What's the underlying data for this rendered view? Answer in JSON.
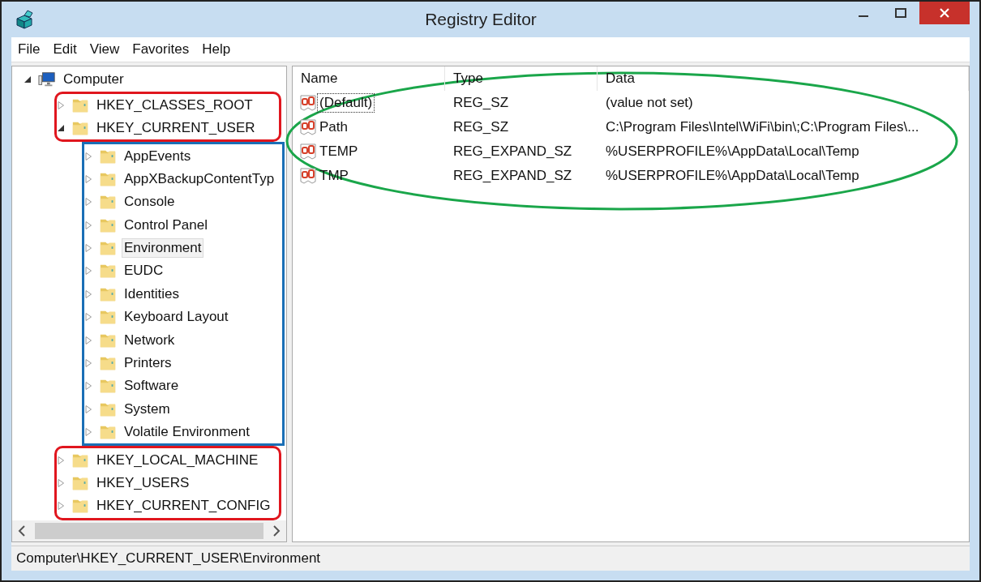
{
  "window": {
    "title": "Registry Editor"
  },
  "menu": [
    "File",
    "Edit",
    "View",
    "Favorites",
    "Help"
  ],
  "tree": [
    {
      "label": "Computer",
      "kind": "computer",
      "expanded": true,
      "selected": false,
      "children": [
        {
          "label": "HKEY_CLASSES_ROOT",
          "expanded": false,
          "selected": false,
          "outlined": true
        },
        {
          "label": "HKEY_CURRENT_USER",
          "expanded": true,
          "selected": false,
          "outlined": true,
          "children": [
            {
              "label": "AppEvents",
              "expanded": false,
              "selected": false,
              "outlined": true
            },
            {
              "label": "AppXBackupContentTyp",
              "expanded": false,
              "selected": false,
              "outlined": true
            },
            {
              "label": "Console",
              "expanded": false,
              "selected": false,
              "outlined": true
            },
            {
              "label": "Control Panel",
              "expanded": false,
              "selected": false,
              "outlined": true
            },
            {
              "label": "Environment",
              "expanded": false,
              "selected": true,
              "outlined": true
            },
            {
              "label": "EUDC",
              "expanded": false,
              "selected": false,
              "outlined": true
            },
            {
              "label": "Identities",
              "expanded": false,
              "selected": false,
              "outlined": true
            },
            {
              "label": "Keyboard Layout",
              "expanded": false,
              "selected": false,
              "outlined": true
            },
            {
              "label": "Network",
              "expanded": false,
              "selected": false,
              "outlined": true
            },
            {
              "label": "Printers",
              "expanded": false,
              "selected": false,
              "outlined": true
            },
            {
              "label": "Software",
              "expanded": false,
              "selected": false,
              "outlined": true
            },
            {
              "label": "System",
              "expanded": false,
              "selected": false,
              "outlined": true
            },
            {
              "label": "Volatile Environment",
              "expanded": false,
              "selected": false,
              "outlined": true
            }
          ]
        },
        {
          "label": "HKEY_LOCAL_MACHINE",
          "expanded": false,
          "selected": false,
          "outlined": true
        },
        {
          "label": "HKEY_USERS",
          "expanded": false,
          "selected": false,
          "outlined": true
        },
        {
          "label": "HKEY_CURRENT_CONFIG",
          "expanded": false,
          "selected": false,
          "outlined": true
        }
      ]
    }
  ],
  "values": {
    "outlined": true,
    "columns": [
      "Name",
      "Type",
      "Data"
    ],
    "rows": [
      {
        "name": "(Default)",
        "type": "REG_SZ",
        "data": "(value not set)",
        "focused": true
      },
      {
        "name": "Path",
        "type": "REG_SZ",
        "data": "C:\\Program Files\\Intel\\WiFi\\bin\\;C:\\Program Files\\...",
        "focused": false
      },
      {
        "name": "TEMP",
        "type": "REG_EXPAND_SZ",
        "data": "%USERPROFILE%\\AppData\\Local\\Temp",
        "focused": false
      },
      {
        "name": "TMP",
        "type": "REG_EXPAND_SZ",
        "data": "%USERPROFILE%\\AppData\\Local\\Temp",
        "focused": false
      }
    ]
  },
  "status_bar": "Computer\\HKEY_CURRENT_USER\\Environment"
}
